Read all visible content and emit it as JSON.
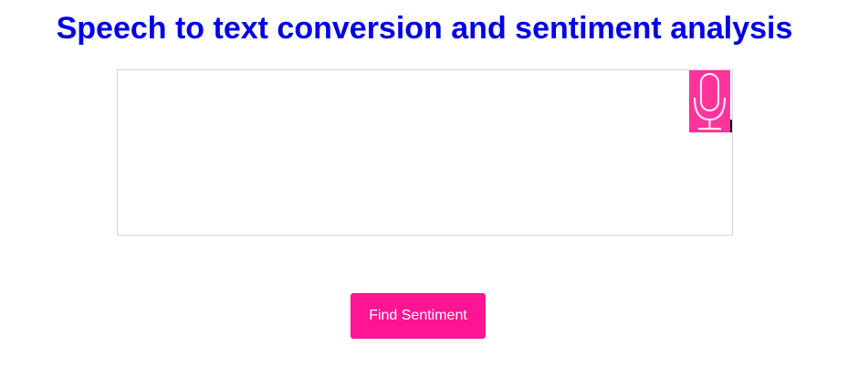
{
  "page": {
    "title": "Speech to text conversion and sentiment analysis"
  },
  "transcript": {
    "value": "",
    "placeholder": ""
  },
  "mic": {
    "icon": "microphone-icon"
  },
  "actions": {
    "find_sentiment_label": "Find Sentiment"
  },
  "colors": {
    "title": "#0000e6",
    "mic_background": "#ff3399",
    "button_background": "#ff1493",
    "button_text": "#ffffff",
    "textarea_border": "#d6d6d6"
  }
}
